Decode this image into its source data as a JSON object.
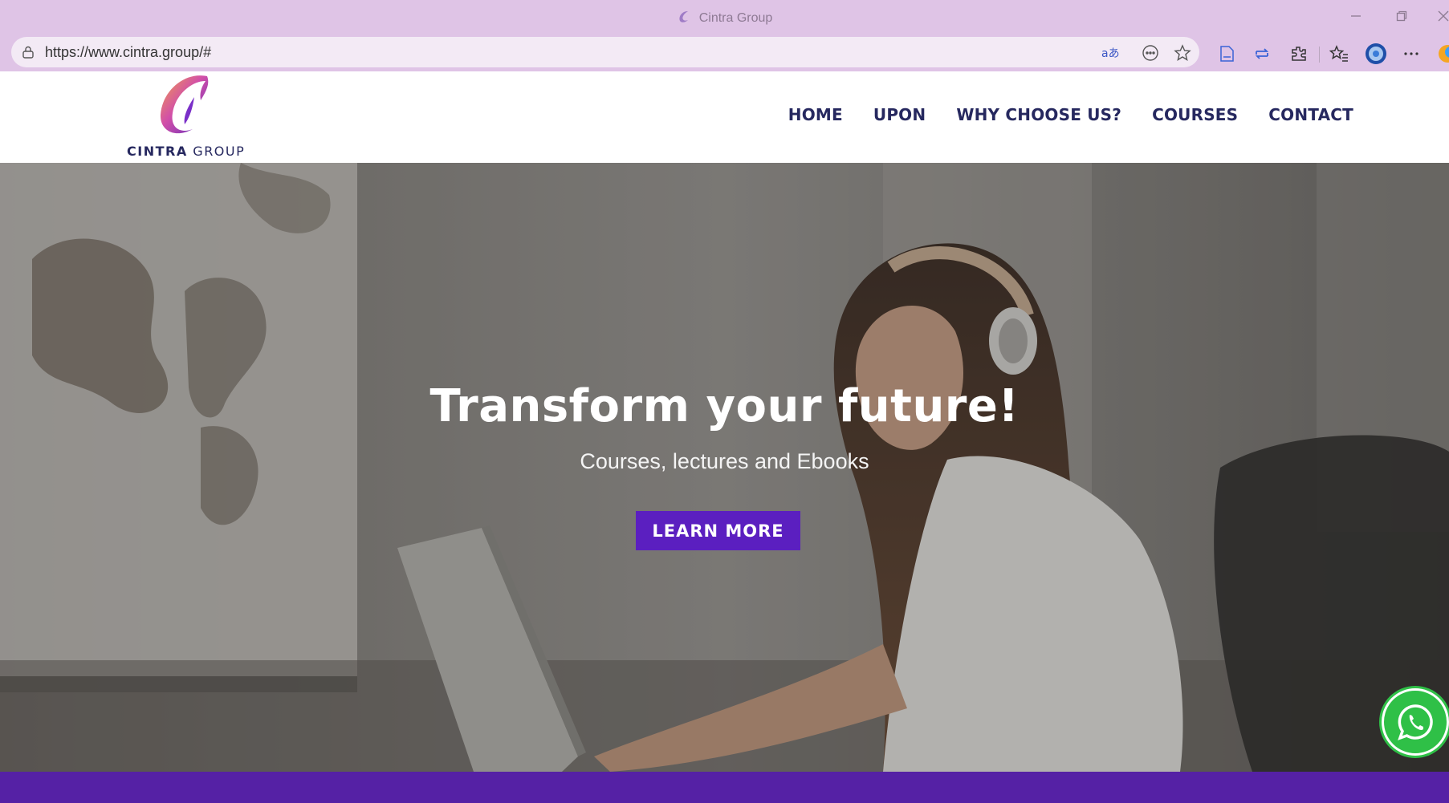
{
  "browser": {
    "tab_title": "Cintra Group",
    "url": "https://www.cintra.group/#",
    "icons": [
      "lock-icon",
      "read-aloud-icon",
      "more-tools-icon",
      "favorite-star-icon",
      "reading-view-icon",
      "refresh-sync-icon",
      "extensions-icon",
      "favorites-icon",
      "profile-icon",
      "more-options-icon",
      "minimize-icon",
      "restore-icon",
      "close-icon"
    ]
  },
  "site": {
    "logo": {
      "word_bold": "CINTRA",
      "word_light": " GROUP"
    },
    "nav": [
      {
        "label": "HOME"
      },
      {
        "label": "UPON"
      },
      {
        "label": "WHY CHOOSE US?"
      },
      {
        "label": "COURSES"
      },
      {
        "label": "CONTACT"
      }
    ]
  },
  "hero": {
    "title": "Transform your future!",
    "subtitle": "Courses, lectures and Ebooks",
    "button": "LEARN MORE"
  },
  "colors": {
    "chrome": "#dfc4e6",
    "nav_text": "#26285f",
    "accent_purple": "#5b1fc0",
    "footer_band": "#5521a5",
    "whatsapp_green": "#2fc047"
  }
}
